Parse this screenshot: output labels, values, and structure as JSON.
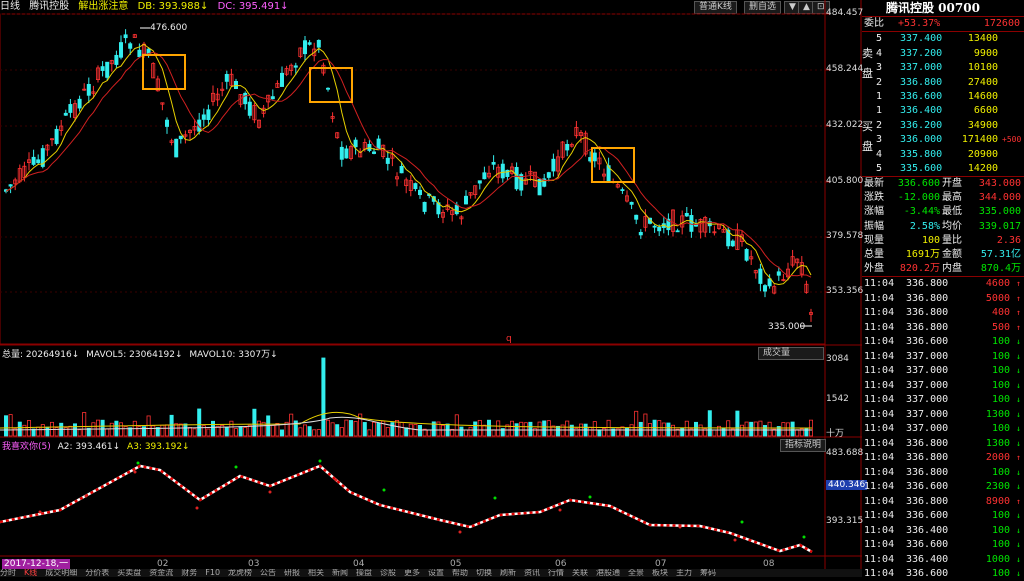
{
  "header": {
    "period": "日线",
    "stock_name": "腾讯控股",
    "indicator_name": "解出涨注意",
    "db": "DB: 393.988↓",
    "dc": "DC: 395.491↓",
    "kline_button": "普通K线",
    "remove_button": "删自选",
    "nav_labels": [
      "▼",
      "▲",
      "⊡"
    ]
  },
  "price_axis": {
    "ticks": [
      "484.457",
      "458.244",
      "432.022",
      "405.800",
      "379.578",
      "353.356"
    ]
  },
  "price_annotations": {
    "high": "476.600",
    "low": "335.000",
    "marker": "q"
  },
  "volume_header": {
    "total": "总量: 20264916↓",
    "mavol5": "MAVOL5: 23064192↓",
    "mavol10": "MAVOL10: 3307万↓",
    "button": "成交量"
  },
  "volume_axis": {
    "ticks": [
      "3084",
      "1542"
    ],
    "unit": "十万"
  },
  "ind_header": {
    "name": "我喜欢你(5)",
    "a2": "A2: 393.461↓",
    "a3": "A3: 393.192↓",
    "button": "指标说明"
  },
  "ind_axis": {
    "ticks": [
      "483.688",
      "393.315"
    ],
    "badge": "440.346"
  },
  "x_axis": {
    "date_badge": "2017-12-18,一",
    "months": [
      "02",
      "03",
      "04",
      "05",
      "06",
      "07",
      "08"
    ]
  },
  "bottom_tabs": [
    "分时",
    "K线",
    "成交明细",
    "分价表",
    "买卖盘",
    "资金流",
    "财务",
    "F10",
    "龙虎榜",
    "公告",
    "研报",
    "相关",
    "新闻",
    "操盘",
    "诊股",
    "更多",
    "设置",
    "帮助",
    "切换",
    "刷新",
    "资讯",
    "行情",
    "关联",
    "港股通",
    "全景",
    "板块",
    "主力",
    "筹码"
  ],
  "quote": {
    "title": "腾讯控股 00700",
    "weibi": {
      "label": "委比",
      "pct": "+53.37%",
      "diff": "172600"
    },
    "sell_label": "卖盘",
    "buy_label": "买盘",
    "sell": [
      {
        "lvl": "5",
        "price": "337.400",
        "vol": "13400",
        "chg": ""
      },
      {
        "lvl": "4",
        "price": "337.200",
        "vol": "9900",
        "chg": ""
      },
      {
        "lvl": "3",
        "price": "337.000",
        "vol": "10100",
        "chg": ""
      },
      {
        "lvl": "2",
        "price": "336.800",
        "vol": "27400",
        "chg": ""
      },
      {
        "lvl": "1",
        "price": "336.600",
        "vol": "14600",
        "chg": ""
      }
    ],
    "buy": [
      {
        "lvl": "1",
        "price": "336.400",
        "vol": "6600",
        "chg": ""
      },
      {
        "lvl": "2",
        "price": "336.200",
        "vol": "34900",
        "chg": ""
      },
      {
        "lvl": "3",
        "price": "336.000",
        "vol": "171400",
        "chg": "+500"
      },
      {
        "lvl": "4",
        "price": "335.800",
        "vol": "20900",
        "chg": ""
      },
      {
        "lvl": "5",
        "price": "335.600",
        "vol": "14200",
        "chg": ""
      }
    ],
    "stats": [
      {
        "l1": "最新",
        "v1": "336.600",
        "l2": "开盘",
        "v2": "343.000",
        "c1": "grn",
        "c2": "red"
      },
      {
        "l1": "涨跌",
        "v1": "-12.000",
        "l2": "最高",
        "v2": "344.000",
        "c1": "grn",
        "c2": "red"
      },
      {
        "l1": "涨幅",
        "v1": "-3.44%",
        "l2": "最低",
        "v2": "335.000",
        "c1": "grn",
        "c2": "grn"
      },
      {
        "l1": "振幅",
        "v1": "2.58%",
        "l2": "均价",
        "v2": "339.017",
        "c1": "cyn",
        "c2": "grn"
      },
      {
        "l1": "现量",
        "v1": "100",
        "l2": "量比",
        "v2": "2.36",
        "c1": "yel",
        "c2": "red"
      },
      {
        "l1": "总量",
        "v1": "1691万",
        "l2": "金额",
        "v2": "57.31亿",
        "c1": "yel",
        "c2": "cyn"
      },
      {
        "l1": "外盘",
        "v1": "820.2万",
        "l2": "内盘",
        "v2": "870.4万",
        "c1": "red",
        "c2": "grn"
      }
    ],
    "ticks": [
      {
        "t": "11:04",
        "p": "336.800",
        "v": "4600",
        "d": "up"
      },
      {
        "t": "11:04",
        "p": "336.800",
        "v": "5000",
        "d": "up"
      },
      {
        "t": "11:04",
        "p": "336.800",
        "v": "400",
        "d": "up"
      },
      {
        "t": "11:04",
        "p": "336.800",
        "v": "500",
        "d": "up"
      },
      {
        "t": "11:04",
        "p": "336.600",
        "v": "100",
        "d": "dn"
      },
      {
        "t": "11:04",
        "p": "337.000",
        "v": "100",
        "d": "dn"
      },
      {
        "t": "11:04",
        "p": "337.000",
        "v": "100",
        "d": "dn"
      },
      {
        "t": "11:04",
        "p": "337.000",
        "v": "100",
        "d": "dn"
      },
      {
        "t": "11:04",
        "p": "337.000",
        "v": "100",
        "d": "dn"
      },
      {
        "t": "11:04",
        "p": "337.000",
        "v": "1300",
        "d": "dn"
      },
      {
        "t": "11:04",
        "p": "337.000",
        "v": "100",
        "d": "dn"
      },
      {
        "t": "11:04",
        "p": "336.800",
        "v": "1300",
        "d": "dn"
      },
      {
        "t": "11:04",
        "p": "336.800",
        "v": "2000",
        "d": "up"
      },
      {
        "t": "11:04",
        "p": "336.800",
        "v": "100",
        "d": "dn"
      },
      {
        "t": "11:04",
        "p": "336.600",
        "v": "2300",
        "d": "dn"
      },
      {
        "t": "11:04",
        "p": "336.800",
        "v": "8900",
        "d": "up"
      },
      {
        "t": "11:04",
        "p": "336.600",
        "v": "100",
        "d": "dn"
      },
      {
        "t": "11:04",
        "p": "336.400",
        "v": "100",
        "d": "dn"
      },
      {
        "t": "11:04",
        "p": "336.600",
        "v": "100",
        "d": "dn"
      },
      {
        "t": "11:04",
        "p": "336.400",
        "v": "1000",
        "d": "dn"
      },
      {
        "t": "11:04",
        "p": "336.600",
        "v": "100",
        "d": "dn"
      }
    ],
    "colors": {
      "up": "#ff3232",
      "down": "#00e600",
      "neutral": "#eeeeee"
    }
  }
}
